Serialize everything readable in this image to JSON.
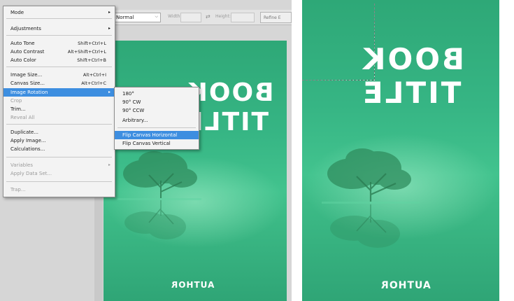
{
  "options_bar": {
    "style_value": "Normal",
    "width_label": "Width:",
    "height_label": "Height:",
    "refine_label": "Refine E"
  },
  "image_menu": {
    "items": [
      {
        "label": "Mode",
        "submenu": true
      },
      {
        "label": "Adjustments",
        "submenu": true
      },
      {
        "label": "Auto Tone",
        "shortcut": "Shift+Ctrl+L"
      },
      {
        "label": "Auto Contrast",
        "shortcut": "Alt+Shift+Ctrl+L"
      },
      {
        "label": "Auto Color",
        "shortcut": "Shift+Ctrl+B"
      },
      {
        "label": "Image Size...",
        "shortcut": "Alt+Ctrl+I"
      },
      {
        "label": "Canvas Size...",
        "shortcut": "Alt+Ctrl+C"
      },
      {
        "label": "Image Rotation",
        "submenu": true,
        "selected": true
      },
      {
        "label": "Crop",
        "disabled": true
      },
      {
        "label": "Trim..."
      },
      {
        "label": "Reveal All",
        "disabled": true
      },
      {
        "label": "Duplicate..."
      },
      {
        "label": "Apply Image..."
      },
      {
        "label": "Calculations..."
      },
      {
        "label": "Variables",
        "submenu": true,
        "disabled": true
      },
      {
        "label": "Apply Data Set...",
        "disabled": true
      },
      {
        "label": "Trap...",
        "disabled": true
      }
    ]
  },
  "rotation_submenu": {
    "items": [
      {
        "label": "180°"
      },
      {
        "label": "90° CW"
      },
      {
        "label": "90° CCW"
      },
      {
        "label": "Arbitrary..."
      },
      {
        "label": "Flip Canvas Horizontal",
        "selected": true
      },
      {
        "label": "Flip Canvas Vertical"
      }
    ]
  },
  "cover_left": {
    "title_line1": "BOOK",
    "title_line2": "TITLE",
    "author": "AUTHOR"
  },
  "cover_right": {
    "title_line1": "BOOK",
    "title_line2": "TITLE",
    "author": "AUTHOR"
  },
  "colors": {
    "menu_highlight": "#3d8ee0",
    "cover_green": "#36b584",
    "panel_gray": "#d6d6d6"
  },
  "icons": [
    "submenu-arrow-icon",
    "dropdown-arrow-icon",
    "swap-icon",
    "tree-icon"
  ]
}
